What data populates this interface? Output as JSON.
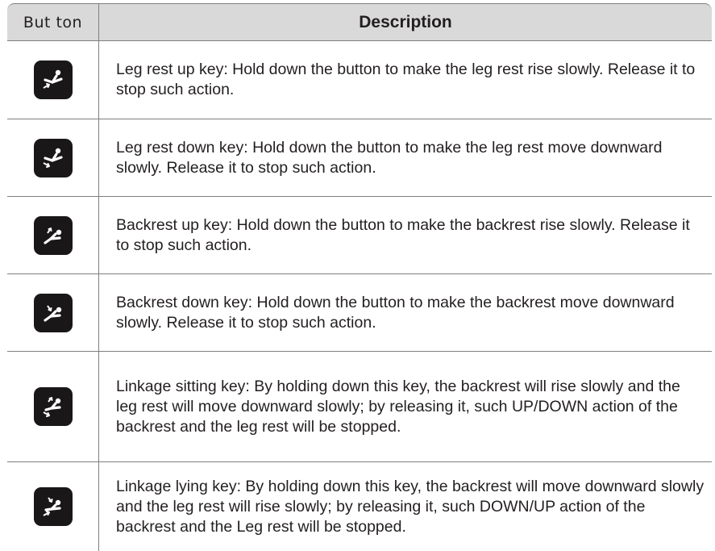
{
  "table": {
    "header": {
      "button": "But ton",
      "description": "Description"
    },
    "rows": [
      {
        "icon": "leg-rest-up-icon",
        "description": "Leg rest up key: Hold down the button to make the leg rest rise slowly. Release it to stop such action."
      },
      {
        "icon": "leg-rest-down-icon",
        "description": "Leg rest down key: Hold down the button to make the leg rest move downward slowly. Release it to stop such action."
      },
      {
        "icon": "backrest-up-icon",
        "description": "Backrest up key: Hold down the button to make the backrest rise slowly. Release it to stop such action."
      },
      {
        "icon": "backrest-down-icon",
        "description": "Backrest down key: Hold down the button to make the backrest move downward slowly. Release it to stop such action."
      },
      {
        "icon": "linkage-sitting-icon",
        "description": "Linkage sitting key: By holding down this key, the backrest will rise slowly and the leg rest will move downward slowly; by releasing it, such UP/DOWN action of the backrest and the leg rest will be stopped."
      },
      {
        "icon": "linkage-lying-icon",
        "description": "Linkage lying key: By holding down this key, the backrest will move downward slowly and the leg rest will rise slowly; by releasing it, such DOWN/UP action of the backrest and the Leg rest will be stopped."
      }
    ]
  },
  "colors": {
    "header_bg": "#d9d9d9",
    "border": "#7f7f7f",
    "text": "#231f20",
    "key_bg": "#1a1718",
    "key_fg": "#ffffff"
  }
}
